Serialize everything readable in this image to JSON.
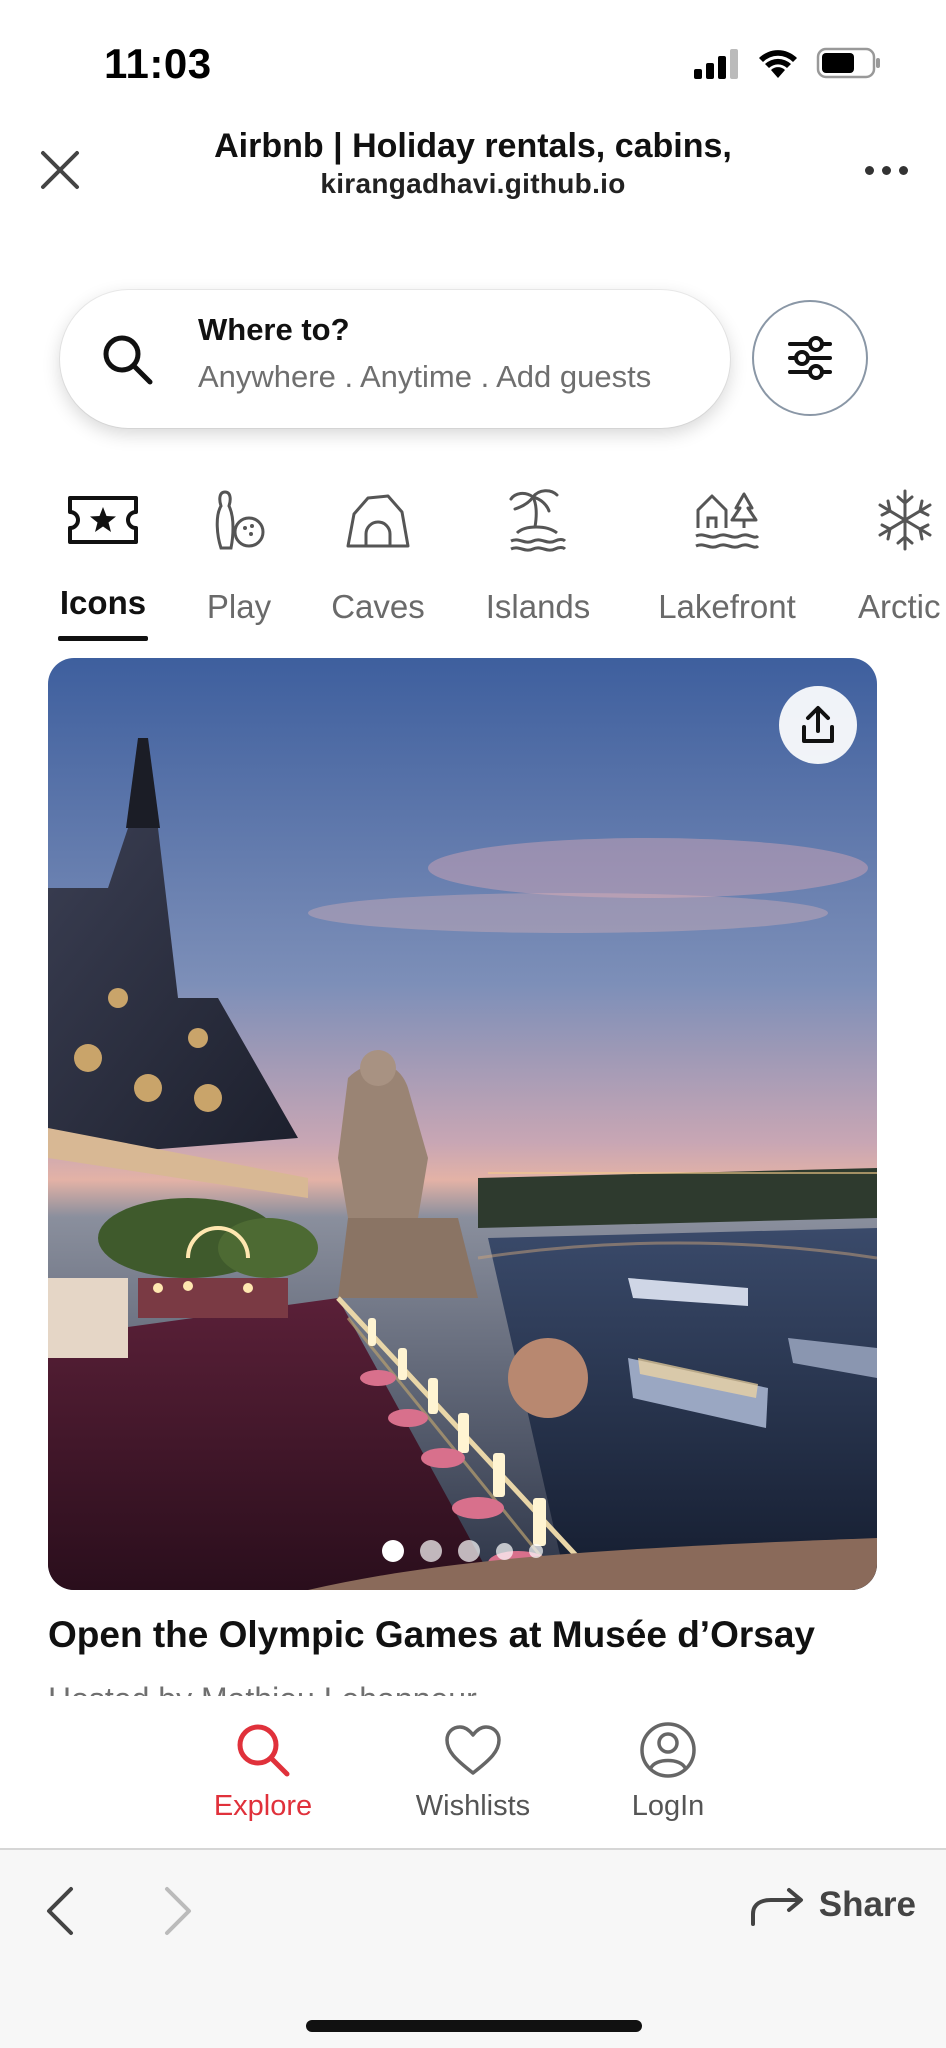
{
  "status_bar": {
    "time": "11:03"
  },
  "browser": {
    "title": "Airbnb | Holiday rentals, cabins,",
    "url": "kirangadhavi.github.io"
  },
  "search": {
    "title": "Where to?",
    "subtitle": "Anywhere . Anytime . Add guests"
  },
  "categories": [
    {
      "label": "Icons",
      "icon": "ticket-star-icon",
      "active": true
    },
    {
      "label": "Play",
      "icon": "bowling-icon"
    },
    {
      "label": "Caves",
      "icon": "cave-icon"
    },
    {
      "label": "Islands",
      "icon": "island-icon"
    },
    {
      "label": "Lakefront",
      "icon": "lakefront-icon"
    },
    {
      "label": "Arctic",
      "icon": "snowflake-icon"
    }
  ],
  "listing": {
    "title": "Open the Olympic Games at Musée d’Orsay",
    "subtitle": "Hosted by Mathieu Lehanneur",
    "image_count": 5,
    "active_image_index": 0
  },
  "tabbar": [
    {
      "label": "Explore",
      "icon": "search-icon",
      "active": true
    },
    {
      "label": "Wishlists",
      "icon": "heart-icon"
    },
    {
      "label": "LogIn",
      "icon": "user-circle-icon"
    }
  ],
  "toolbar": {
    "share_label": "Share"
  },
  "colors": {
    "accent": "#e0313b",
    "text": "#222222",
    "muted": "#6a6a6a"
  }
}
